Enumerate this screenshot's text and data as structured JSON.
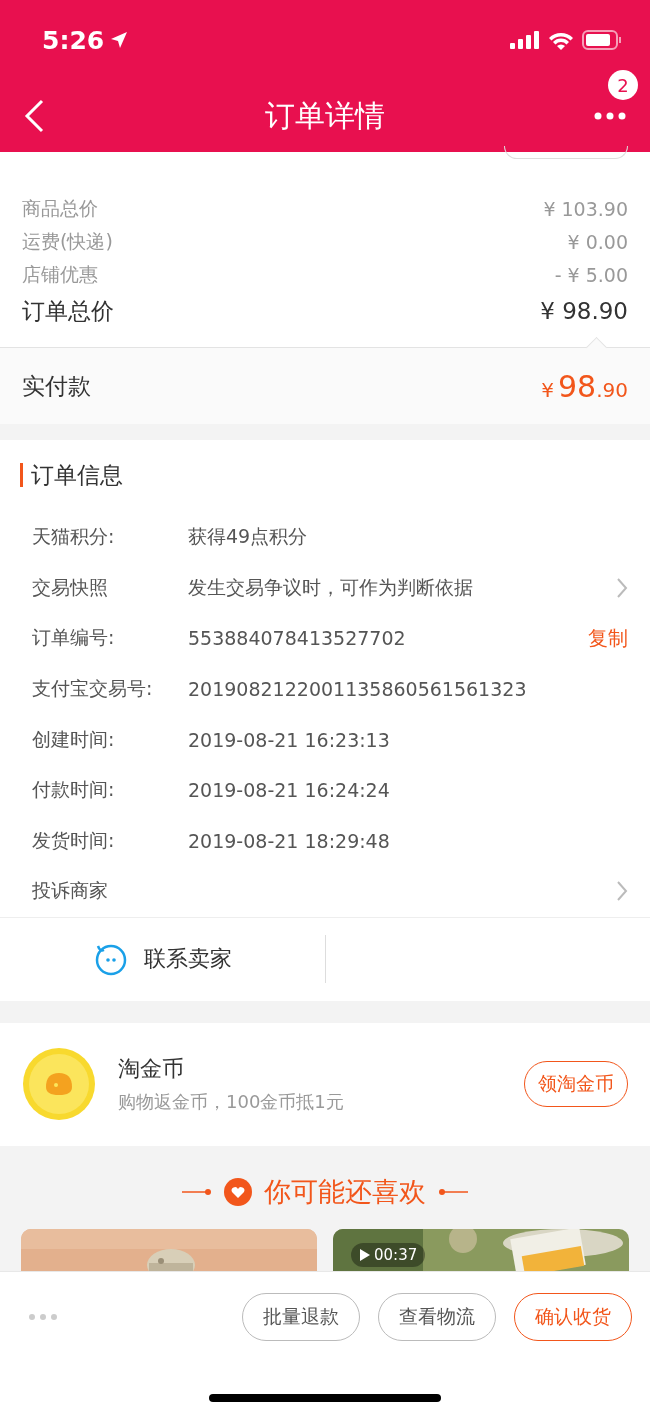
{
  "status_bar": {
    "time": "5:26"
  },
  "nav": {
    "title": "订单详情",
    "badge": "2"
  },
  "price_rows": [
    {
      "label": "商品总价",
      "value": "¥ 103.90",
      "kind": "minor"
    },
    {
      "label": "运费(快递)",
      "value": "¥ 0.00",
      "kind": "minor"
    },
    {
      "label": "店铺优惠",
      "value": "- ¥ 5.00",
      "kind": "minor"
    },
    {
      "label": "订单总价",
      "value": "¥ 98.90",
      "kind": "total"
    }
  ],
  "paid": {
    "label": "实付款",
    "currency": "¥",
    "integer": "98",
    "decimal": ".90"
  },
  "order_info": {
    "title": "订单信息",
    "rows": [
      {
        "label": "天猫积分:",
        "value": "获得49点积分",
        "kind": "plain"
      },
      {
        "label": "交易快照",
        "value": "发生交易争议时，可作为判断依据",
        "kind": "link"
      },
      {
        "label": "订单编号:",
        "value": "553884078413527702",
        "kind": "copy",
        "action": "复制"
      },
      {
        "label": "支付宝交易号:",
        "value": "2019082122001135860561561323",
        "kind": "plain"
      },
      {
        "label": "创建时间:",
        "value": "2019-08-21 16:23:13",
        "kind": "plain"
      },
      {
        "label": "付款时间:",
        "value": "2019-08-21 16:24:24",
        "kind": "plain"
      },
      {
        "label": "发货时间:",
        "value": "2019-08-21 18:29:48",
        "kind": "plain"
      },
      {
        "label": "投诉商家",
        "kind": "link"
      }
    ],
    "contact": "联系卖家"
  },
  "coins": {
    "title": "淘金币",
    "subtitle": "购物返金币，100金币抵1元",
    "button": "领淘金币"
  },
  "recommend": {
    "title": "你可能还喜欢",
    "items": [
      {
        "kind": "picture"
      },
      {
        "kind": "picture",
        "duration": "00:37"
      }
    ]
  },
  "actions": [
    {
      "label": "批量退款",
      "primary": false
    },
    {
      "label": "查看物流",
      "primary": false
    },
    {
      "label": "确认收货",
      "primary": true
    }
  ]
}
